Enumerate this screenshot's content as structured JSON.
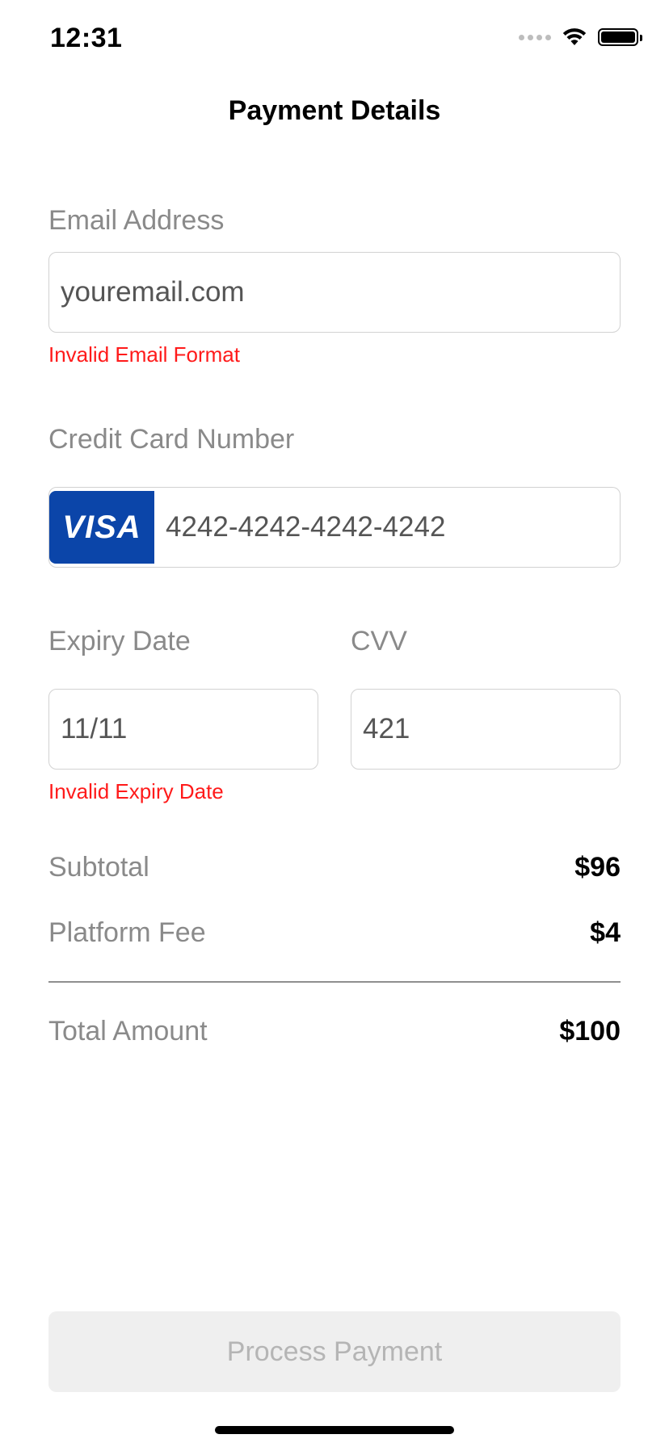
{
  "status_bar": {
    "time": "12:31"
  },
  "header": {
    "title": "Payment Details"
  },
  "email": {
    "label": "Email Address",
    "value": "youremail.com",
    "error": "Invalid Email Format"
  },
  "card": {
    "label": "Credit Card Number",
    "brand": "VISA",
    "value": "4242-4242-4242-4242"
  },
  "expiry": {
    "label": "Expiry Date",
    "value": "11/11",
    "error": "Invalid Expiry Date"
  },
  "cvv": {
    "label": "CVV",
    "value": "421"
  },
  "summary": {
    "subtotal_label": "Subtotal",
    "subtotal_value": "$96",
    "fee_label": "Platform Fee",
    "fee_value": "$4",
    "total_label": "Total Amount",
    "total_value": "$100"
  },
  "actions": {
    "process_label": "Process Payment"
  },
  "colors": {
    "error": "#ff1a1a",
    "visa_blue": "#0b45a9",
    "label_gray": "#8a8a8a",
    "button_disabled_bg": "#efefef"
  },
  "icons": {
    "wifi": "wifi-icon",
    "battery": "battery-icon",
    "signal": "signal-dots-icon"
  }
}
